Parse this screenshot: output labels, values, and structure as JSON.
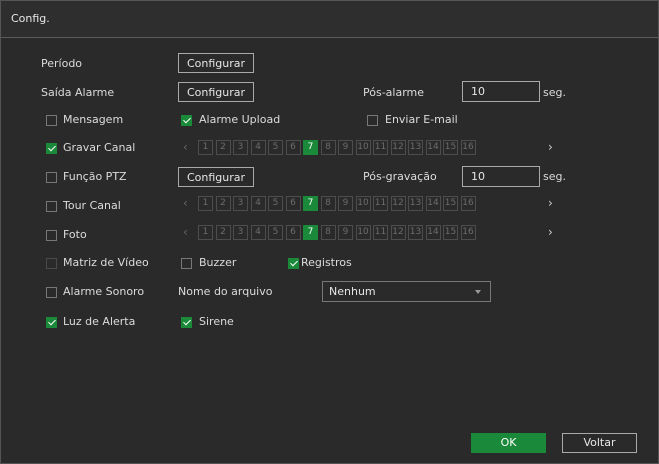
{
  "window": {
    "title": "Config."
  },
  "periodo": {
    "label": "Período",
    "button": "Configurar"
  },
  "saida_alarme": {
    "label": "Saída Alarme",
    "button": "Configurar",
    "pos_label": "Pós-alarme",
    "pos_value": "10",
    "unit": "seg."
  },
  "mensagem": {
    "label": "Mensagem",
    "checked": false
  },
  "alarme_upload": {
    "label": "Alarme Upload",
    "checked": true
  },
  "enviar_email": {
    "label": "Enviar E-mail",
    "checked": false
  },
  "gravar_canal": {
    "label": "Gravar Canal",
    "checked": true
  },
  "funcao_ptz": {
    "label": "Função PTZ",
    "checked": false,
    "button": "Configurar",
    "pos_label": "Pós-gravação",
    "pos_value": "10",
    "unit": "seg."
  },
  "tour_canal": {
    "label": "Tour Canal",
    "checked": false
  },
  "foto": {
    "label": "Foto",
    "checked": false
  },
  "matriz_video": {
    "label": "Matriz de Vídeo",
    "checked": false
  },
  "buzzer": {
    "label": "Buzzer",
    "checked": false
  },
  "registros": {
    "label": "Registros",
    "checked": true
  },
  "alarme_sonoro": {
    "label": "Alarme Sonoro",
    "checked": false,
    "file_label": "Nome do arquivo",
    "file_value": "Nenhum"
  },
  "luz_alerta": {
    "label": "Luz de Alerta",
    "checked": true
  },
  "sirene": {
    "label": "Sirene",
    "checked": true
  },
  "channels": {
    "prev": "‹",
    "next": "›",
    "selected": "7",
    "items": [
      "1",
      "2",
      "3",
      "4",
      "5",
      "6",
      "7",
      "8",
      "9",
      "10",
      "11",
      "12",
      "13",
      "14",
      "15",
      "16"
    ]
  },
  "footer": {
    "ok": "OK",
    "back": "Voltar"
  },
  "colors": {
    "accent": "#1a8a3a",
    "background": "#2a2a2a"
  },
  "icons": {
    "checkbox": "checkbox-icon",
    "caret": "chevron-down-icon"
  }
}
